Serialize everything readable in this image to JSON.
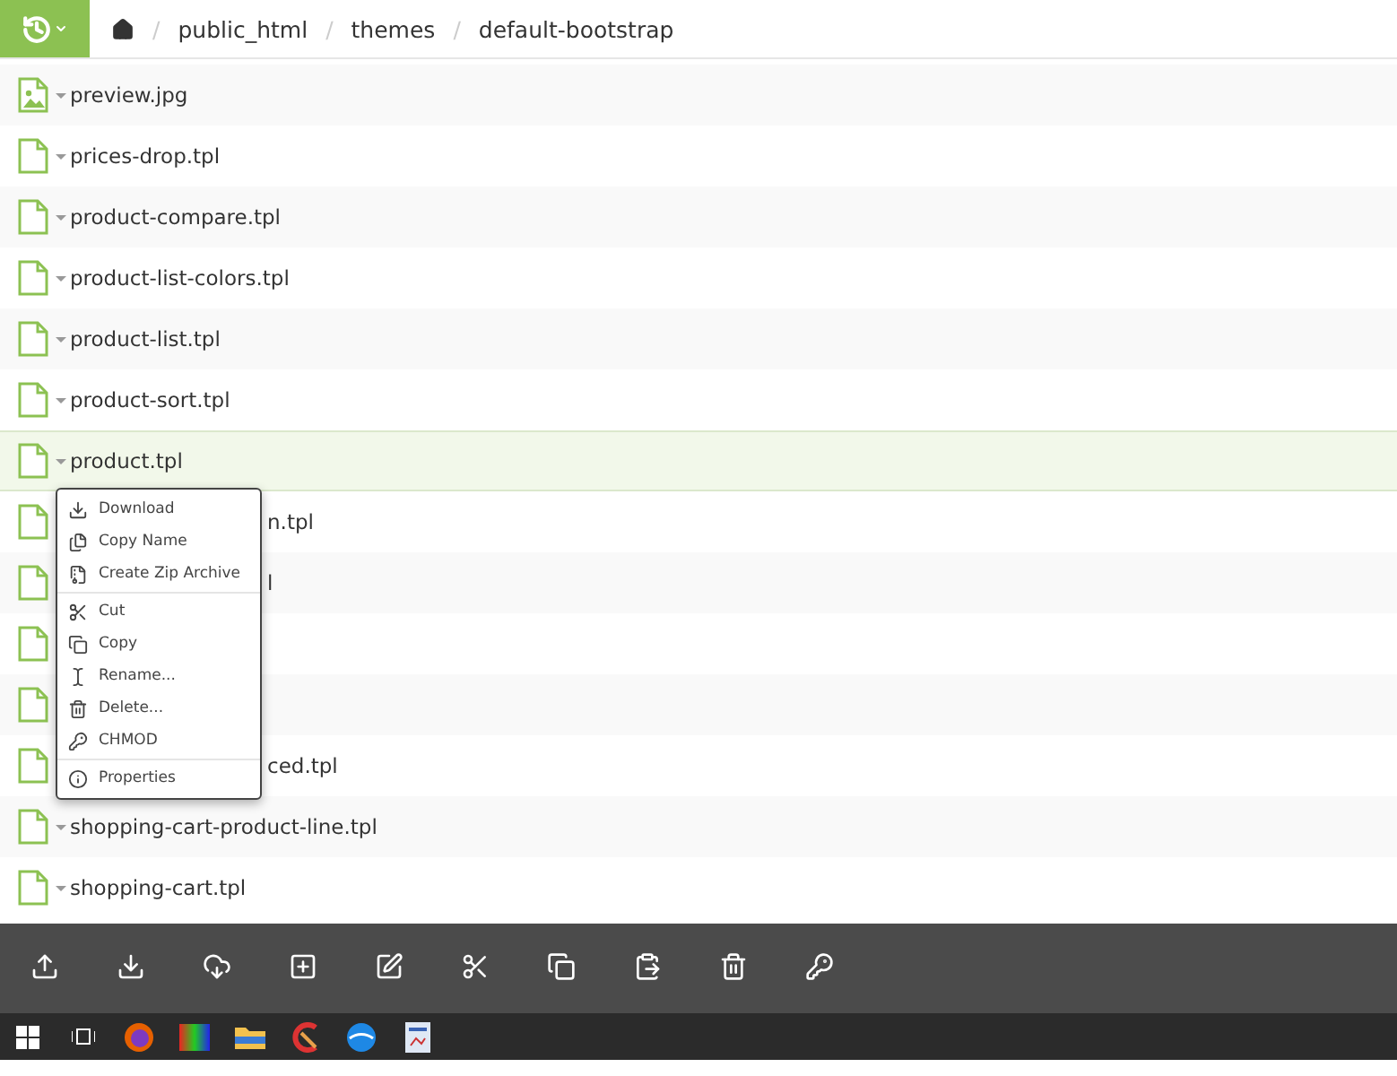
{
  "breadcrumb": [
    {
      "separator": "/",
      "label": "public_html"
    },
    {
      "separator": "/",
      "label": "themes"
    },
    {
      "separator": "/",
      "label": "default-bootstrap"
    }
  ],
  "files": [
    {
      "name": "preview.jpg",
      "kind": "image",
      "selected": false,
      "covered": false
    },
    {
      "name": "prices-drop.tpl",
      "kind": "file",
      "selected": false,
      "covered": false
    },
    {
      "name": "product-compare.tpl",
      "kind": "file",
      "selected": false,
      "covered": false
    },
    {
      "name": "product-list-colors.tpl",
      "kind": "file",
      "selected": false,
      "covered": false
    },
    {
      "name": "product-list.tpl",
      "kind": "file",
      "selected": false,
      "covered": false
    },
    {
      "name": "product-sort.tpl",
      "kind": "file",
      "selected": false,
      "covered": false
    },
    {
      "name": "product.tpl",
      "kind": "file",
      "selected": true,
      "covered": false
    },
    {
      "name": "n.tpl",
      "kind": "file",
      "selected": false,
      "covered": true
    },
    {
      "name": "l",
      "kind": "file",
      "selected": false,
      "covered": true
    },
    {
      "kind": "file",
      "selected": false
    },
    {
      "kind": "file",
      "selected": false
    },
    {
      "name": "ced.tpl",
      "kind": "file",
      "selected": false,
      "covered": true
    },
    {
      "name": "shopping-cart-product-line.tpl",
      "kind": "file",
      "selected": false,
      "covered": false
    },
    {
      "name": "shopping-cart.tpl",
      "kind": "file",
      "selected": false,
      "covered": false
    }
  ],
  "context_menu": {
    "groups": [
      [
        "Download",
        "Copy Name",
        "Create Zip Archive"
      ],
      [
        "Cut",
        "Copy",
        "Rename...",
        "Delete...",
        "CHMOD"
      ],
      [
        "Properties"
      ]
    ]
  }
}
